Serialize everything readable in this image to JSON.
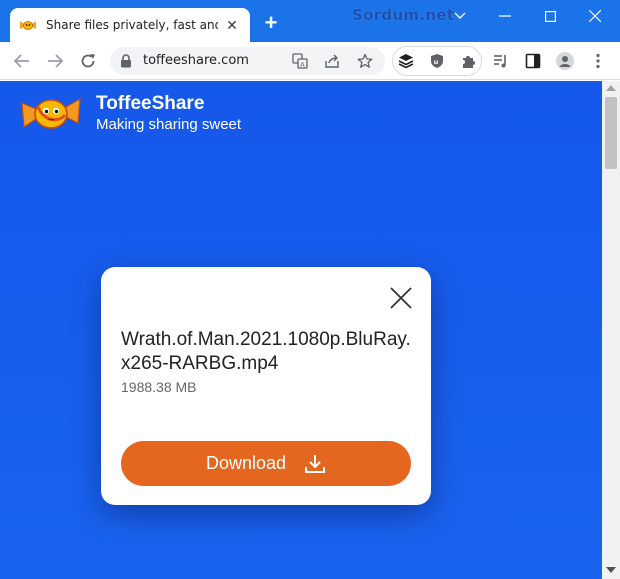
{
  "browser": {
    "tab_title": "Share files privately, fast and without limits",
    "tab_close": "✕",
    "new_tab": "+",
    "watermark": "Sordum.net",
    "url": "toffeeshare.com",
    "accent": "#1a73e8"
  },
  "site": {
    "title": "ToffeeShare",
    "tagline": "Making sharing sweet",
    "background": "#1558ea"
  },
  "file_card": {
    "file_name": "Wrath.of.Man.2021.1080p.BluRay.x265-RARBG.mp4",
    "file_size": "1988.38 MB",
    "download_label": "Download",
    "button_color": "#e5671f"
  }
}
